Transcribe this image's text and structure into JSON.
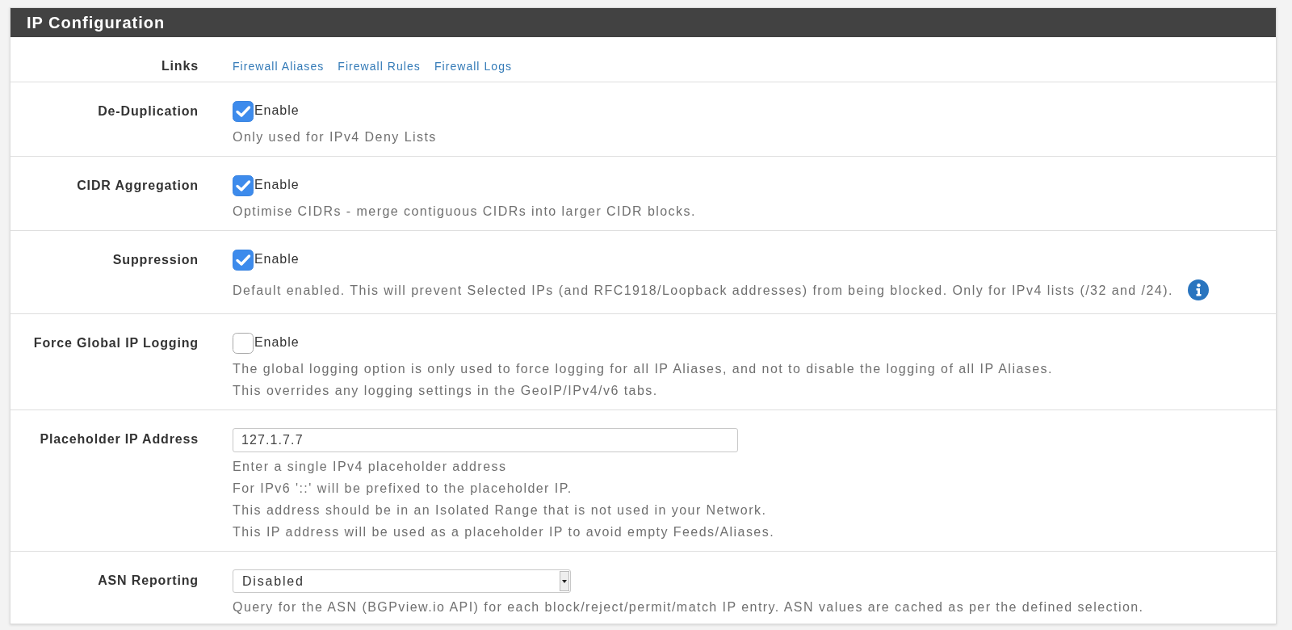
{
  "panel": {
    "title": "IP Configuration"
  },
  "rows": [
    {
      "kind": "links",
      "label": "Links",
      "links": [
        "Firewall Aliases",
        "Firewall Rules",
        "Firewall Logs"
      ]
    },
    {
      "kind": "checkbox",
      "label": "De-Duplication",
      "option": "Enable",
      "checked": true,
      "help": [
        "Only used for IPv4 Deny Lists"
      ]
    },
    {
      "kind": "checkbox",
      "label": "CIDR Aggregation",
      "option": "Enable",
      "checked": true,
      "help": [
        "Optimise CIDRs - merge contiguous CIDRs into larger CIDR blocks."
      ]
    },
    {
      "kind": "checkbox",
      "label": "Suppression",
      "option": "Enable",
      "checked": true,
      "info_icon": true,
      "help": [
        "Default enabled. This will prevent Selected IPs (and RFC1918/Loopback addresses) from being blocked. Only for IPv4 lists (/32 and /24)."
      ]
    },
    {
      "kind": "checkbox",
      "label": "Force Global IP Logging",
      "option": "Enable",
      "checked": false,
      "help": [
        "The global logging option is only used to force logging for all IP Aliases, and not to disable the logging of all IP Aliases.",
        "This overrides any logging settings in the GeoIP/IPv4/v6 tabs."
      ]
    },
    {
      "kind": "text",
      "label": "Placeholder IP Address",
      "value": "127.1.7.7",
      "help": [
        "Enter a single IPv4 placeholder address",
        "For IPv6 '::' will be prefixed to the placeholder IP.",
        "This address should be in an Isolated Range that is not used in your Network.",
        "This IP address will be used as a placeholder IP to avoid empty Feeds/Aliases."
      ]
    },
    {
      "kind": "select",
      "label": "ASN Reporting",
      "value": "Disabled",
      "help": [
        "Query for the ASN (BGPview.io API) for each block/reject/permit/match IP entry. ASN values are cached as per the defined selection."
      ]
    }
  ]
}
